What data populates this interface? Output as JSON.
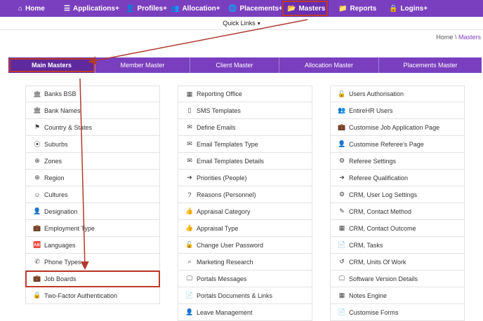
{
  "topnav": {
    "items": [
      {
        "label": "Home",
        "icon": "home-icon",
        "glyph": "⌂"
      },
      {
        "label": "Applications+",
        "icon": "list-icon",
        "glyph": "☰"
      },
      {
        "label": "Profiles+",
        "icon": "user-icon",
        "glyph": "👤"
      },
      {
        "label": "Allocation+",
        "icon": "users-icon",
        "glyph": "👥"
      },
      {
        "label": "Placements+",
        "icon": "globe-icon",
        "glyph": "🌐"
      },
      {
        "label": "Masters",
        "icon": "folder-open-icon",
        "glyph": "📂"
      },
      {
        "label": "Reports",
        "icon": "folder-icon",
        "glyph": "📁"
      },
      {
        "label": "Logins+",
        "icon": "lock-icon",
        "glyph": "🔒"
      }
    ]
  },
  "quick_links": {
    "label": "Quick Links"
  },
  "breadcrumb": {
    "home": "Home",
    "sep": "\\",
    "current": "Masters"
  },
  "tabs": [
    {
      "label": "Main Masters"
    },
    {
      "label": "Member Master"
    },
    {
      "label": "Client Master"
    },
    {
      "label": "Allocation Master"
    },
    {
      "label": "Placements Master"
    }
  ],
  "columns": {
    "left": [
      {
        "label": "Banks BSB",
        "icon": "bank-icon",
        "glyph": "🏛"
      },
      {
        "label": "Bank Names",
        "icon": "bank-icon",
        "glyph": "🏛"
      },
      {
        "label": "Country & States",
        "icon": "flag-icon",
        "glyph": "⚑"
      },
      {
        "label": "Suburbs",
        "icon": "map-marker-icon",
        "glyph": "⦿"
      },
      {
        "label": "Zones",
        "icon": "globe-icon",
        "glyph": "⊕"
      },
      {
        "label": "Region",
        "icon": "globe-icon",
        "glyph": "⊕"
      },
      {
        "label": "Cultures",
        "icon": "smile-icon",
        "glyph": "☺"
      },
      {
        "label": "Designation",
        "icon": "user-icon",
        "glyph": "👤"
      },
      {
        "label": "Employment Type",
        "icon": "briefcase-icon",
        "glyph": "💼"
      },
      {
        "label": "Languages",
        "icon": "language-icon",
        "glyph": "🆎"
      },
      {
        "label": "Phone Types",
        "icon": "phone-icon",
        "glyph": "✆"
      },
      {
        "label": "Job Boards",
        "icon": "briefcase-icon",
        "glyph": "💼"
      },
      {
        "label": "Two-Factor Authentication",
        "icon": "lock-icon",
        "glyph": "🔒"
      }
    ],
    "middle": [
      {
        "label": "Reporting Office",
        "icon": "building-icon",
        "glyph": "▦"
      },
      {
        "label": "SMS Templates",
        "icon": "mobile-icon",
        "glyph": "▯"
      },
      {
        "label": "Define Emails",
        "icon": "envelope-icon",
        "glyph": "✉"
      },
      {
        "label": "Email Templates Type",
        "icon": "envelope-icon",
        "glyph": "✉"
      },
      {
        "label": "Email Templates Details",
        "icon": "envelope-icon",
        "glyph": "✉"
      },
      {
        "label": "Priorities (People)",
        "icon": "arrow-circle-icon",
        "glyph": "➜"
      },
      {
        "label": "Reasons (Personnel)",
        "icon": "question-circle-icon",
        "glyph": "?"
      },
      {
        "label": "Appraisal Category",
        "icon": "thumbs-up-icon",
        "glyph": "👍"
      },
      {
        "label": "Appraisal Type",
        "icon": "thumbs-up-icon",
        "glyph": "👍"
      },
      {
        "label": "Change User Password",
        "icon": "unlock-icon",
        "glyph": "🔓"
      },
      {
        "label": "Marketing Research",
        "icon": "search-icon",
        "glyph": "⌕"
      },
      {
        "label": "Portals Messages",
        "icon": "desktop-icon",
        "glyph": "🖵"
      },
      {
        "label": "Portals Documents & Links",
        "icon": "file-icon",
        "glyph": "📄"
      },
      {
        "label": "Leave Management",
        "icon": "user-clock-icon",
        "glyph": "👤"
      }
    ],
    "right": [
      {
        "label": "Users Authorisation",
        "icon": "unlock-icon",
        "glyph": "🔓"
      },
      {
        "label": "EntireHR Users",
        "icon": "users-icon",
        "glyph": "👥"
      },
      {
        "label": "Customise Job Application Page",
        "icon": "briefcase-icon",
        "glyph": "💼"
      },
      {
        "label": "Customise Referee's Page",
        "icon": "user-plus-icon",
        "glyph": "👤"
      },
      {
        "label": "Referee Settings",
        "icon": "gear-icon",
        "glyph": "⚙"
      },
      {
        "label": "Referee Qualification",
        "icon": "arrow-circle-icon",
        "glyph": "➜"
      },
      {
        "label": "CRM, User Log Settings",
        "icon": "gear-icon",
        "glyph": "⚙"
      },
      {
        "label": "CRM, Contact Method",
        "icon": "paint-brush-icon",
        "glyph": "✎"
      },
      {
        "label": "CRM, Contact Outcome",
        "icon": "grid-icon",
        "glyph": "▦"
      },
      {
        "label": "CRM, Tasks",
        "icon": "file-icon",
        "glyph": "📄"
      },
      {
        "label": "CRM, Units Of Work",
        "icon": "history-icon",
        "glyph": "↺"
      },
      {
        "label": "Software Version Details",
        "icon": "desktop-icon",
        "glyph": "🖵"
      },
      {
        "label": "Notes Engine",
        "icon": "th-icon",
        "glyph": "▦"
      },
      {
        "label": "Customise Forms",
        "icon": "file-icon",
        "glyph": "📄"
      }
    ]
  },
  "colors": {
    "nav_purple": "#7a3fbf",
    "annotation_red": "#c0392b"
  }
}
